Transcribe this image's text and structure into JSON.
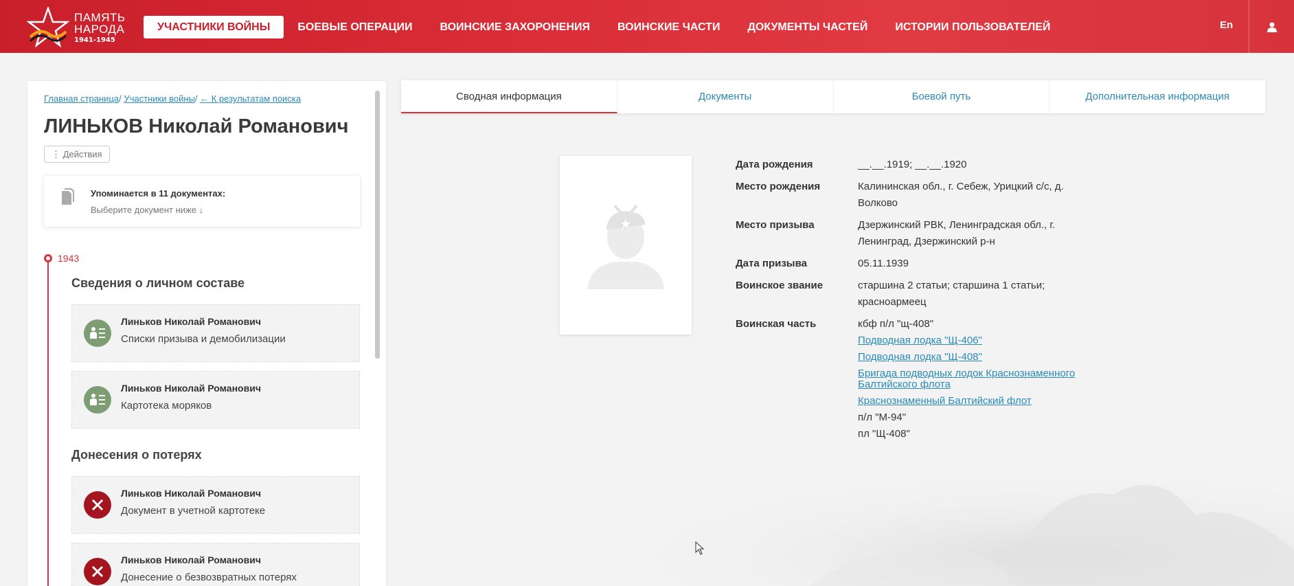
{
  "header": {
    "logo": {
      "line1": "ПАМЯТЬ",
      "line2": "НАРОДА",
      "years": "1941-1945"
    },
    "nav": [
      {
        "label": "УЧАСТНИКИ ВОЙНЫ",
        "active": true
      },
      {
        "label": "БОЕВЫЕ ОПЕРАЦИИ"
      },
      {
        "label": "ВОИНСКИЕ ЗАХОРОНЕНИЯ"
      },
      {
        "label": "ВОИНСКИЕ ЧАСТИ"
      },
      {
        "label": "ДОКУМЕНТЫ ЧАСТЕЙ"
      },
      {
        "label": "ИСТОРИИ ПОЛЬЗОВАТЕЛЕЙ"
      }
    ],
    "lang": "En",
    "accent": "#d6333d"
  },
  "left": {
    "breadcrumb": {
      "home": "Главная страница",
      "sep": "/ ",
      "participants": "Участники войны",
      "back": "← К результатам поиска"
    },
    "name": "ЛИНЬКОВ Николай Романович",
    "actions_label": "⋮ Действия",
    "mentions": {
      "title": "Упоминается в 11 документах:",
      "hint": "Выберите документ ниже ↓"
    },
    "year": "1943",
    "sections": [
      {
        "title": "Сведения о личном составе",
        "docs": [
          {
            "name": "Линьков Николай Романович",
            "desc": "Списки призыва и демобилизации",
            "icon": "person-list-icon"
          },
          {
            "name": "Линьков Николай Романович",
            "desc": "Картотека моряков",
            "icon": "person-list-icon"
          }
        ]
      },
      {
        "title": "Донесения о потерях",
        "docs": [
          {
            "name": "Линьков Николай Романович",
            "desc": "Документ в учетной картотеке",
            "icon": "cross-icon"
          },
          {
            "name": "Линьков Николай Романович",
            "desc": "Донесение о безвозвратных потерях",
            "icon": "cross-icon"
          }
        ]
      }
    ]
  },
  "tabs": [
    {
      "label": "Сводная информация",
      "active": true
    },
    {
      "label": "Документы"
    },
    {
      "label": "Боевой путь"
    },
    {
      "label": "Дополнительная информация"
    }
  ],
  "info": {
    "birth_date_label": "Дата рождения",
    "birth_date": "__.__.1919; __.__.1920",
    "birth_place_label": "Место рождения",
    "birth_place": "Калининская обл., г. Себеж, Урицкий с/с, д. Волково",
    "draft_place_label": "Место призыва",
    "draft_place": "Дзержинский РВК, Ленинградская обл., г. Ленинград, Дзержинский р-н",
    "draft_date_label": "Дата призыва",
    "draft_date": "05.11.1939",
    "rank_label": "Воинское звание",
    "rank": "старшина 2 статьи; старшина 1 статьи; красноармеец",
    "unit_label": "Воинская часть",
    "units": {
      "u1": "кбф п/л \"щ-408\"",
      "u2": "Подводная лодка \"Щ-406\"",
      "u3": "Подводная лодка \"Щ-408\"",
      "u4": "Бригада подводных лодок Краснознаменного Балтийского флота",
      "u5": "Краснознаменный Балтийский флот",
      "u6": "п/л \"М-94\"",
      "u7": "пл \"Щ-408\""
    }
  }
}
